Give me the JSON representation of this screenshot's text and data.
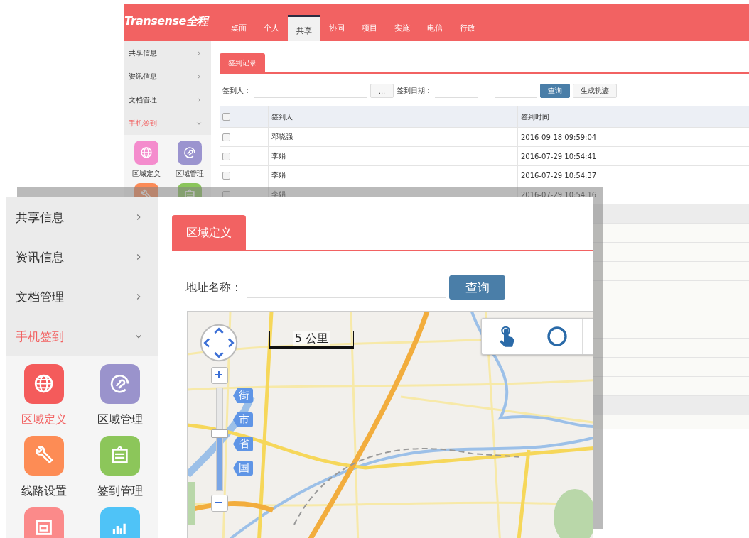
{
  "back_window": {
    "logo": {
      "brand": "Transense全程"
    },
    "nav": [
      {
        "label": "桌面",
        "selected": false
      },
      {
        "label": "个人",
        "selected": false
      },
      {
        "label": "共享",
        "selected": true
      },
      {
        "label": "协同",
        "selected": false
      },
      {
        "label": "项目",
        "selected": false
      },
      {
        "label": "实施",
        "selected": false
      },
      {
        "label": "电信",
        "selected": false
      },
      {
        "label": "行政",
        "selected": false
      }
    ],
    "sidebar": {
      "items": [
        {
          "label": "共享信息",
          "expanded": false
        },
        {
          "label": "资讯信息",
          "expanded": false
        },
        {
          "label": "文档管理",
          "expanded": false
        },
        {
          "label": "手机签到",
          "expanded": true
        }
      ],
      "apps": [
        {
          "label": "区域定义",
          "color": "#f48ccd",
          "selected": false
        },
        {
          "label": "区域管理",
          "color": "#9b94cf",
          "selected": false
        },
        {
          "color": "#fc8b57"
        },
        {
          "color": "#8bc55b"
        }
      ]
    },
    "tabs": [
      {
        "label": "签到记录",
        "selected": true
      }
    ],
    "filter": {
      "person_label": "签到人：",
      "picker_button": "...",
      "date_label": "签到日期：",
      "date_separator": "-",
      "buttons": [
        {
          "label": "查询",
          "kind": "primary"
        },
        {
          "label": "生成轨迹",
          "kind": "default"
        }
      ]
    },
    "table": {
      "columns": [
        "签到人",
        "签到时间"
      ],
      "header_checked": false,
      "rows": [
        {
          "checked": false,
          "name": "邓晓强",
          "time": "2016-09-18 09:59:04"
        },
        {
          "checked": false,
          "name": "李娟",
          "time": "2016-07-29 10:54:41"
        },
        {
          "checked": false,
          "name": "李娟",
          "time": "2016-07-29 10:54:37"
        },
        {
          "checked": false,
          "name": "李娟",
          "time": "2016-07-29 10:54:16"
        }
      ]
    }
  },
  "front_window": {
    "sidebar": {
      "items": [
        {
          "label": "共享信息",
          "expanded": false
        },
        {
          "label": "资讯信息",
          "expanded": false
        },
        {
          "label": "文档管理",
          "expanded": false
        },
        {
          "label": "手机签到",
          "expanded": true
        }
      ],
      "apps": [
        {
          "label": "区域定义",
          "color": "#f45b5b",
          "selected": true
        },
        {
          "label": "区域管理",
          "color": "#9a93cc",
          "selected": false
        },
        {
          "label": "线路设置",
          "color": "#fd8c55",
          "selected": false
        },
        {
          "label": "签到管理",
          "color": "#8cc65a",
          "selected": false
        },
        {
          "color": "#fb8a8a"
        },
        {
          "color": "#4fc3f7"
        }
      ]
    },
    "tabs": [
      {
        "label": "区域定义",
        "selected": true
      }
    ],
    "search": {
      "label": "地址名称：",
      "button": "查询"
    },
    "map": {
      "scale": "5 公里",
      "zoom": {
        "level": 0.55
      },
      "levels": [
        "街",
        "市",
        "省",
        "国"
      ]
    }
  }
}
